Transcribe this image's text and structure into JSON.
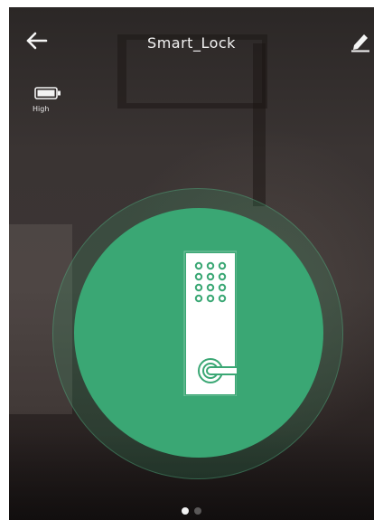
{
  "header": {
    "title": "Smart_Lock",
    "back_icon": "arrow-left-icon",
    "edit_icon": "pencil-icon"
  },
  "battery": {
    "icon": "battery-icon",
    "label": "High"
  },
  "lock": {
    "icon": "door-keypad-lock-icon"
  },
  "pager": {
    "total": 2,
    "active_index": 0
  },
  "colors": {
    "lock_green": "#3aa774",
    "ring_green": "#3ca873",
    "text": "#f2f2f2"
  }
}
